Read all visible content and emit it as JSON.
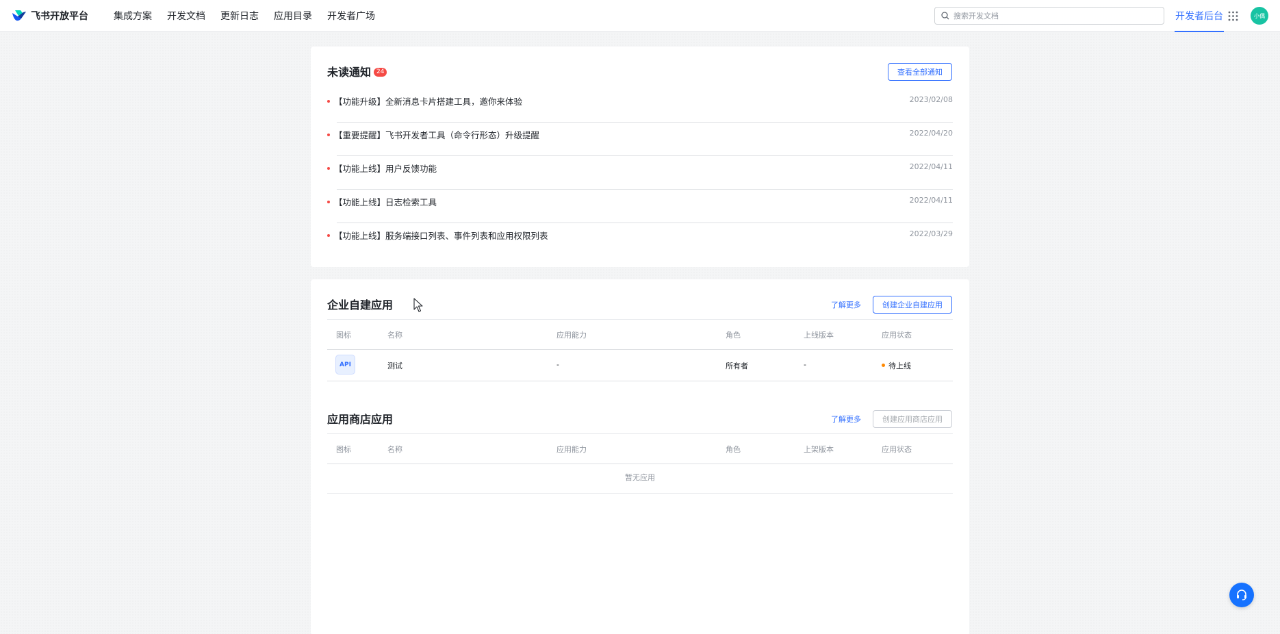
{
  "header": {
    "brand": "飞书开放平台",
    "nav": [
      "集成方案",
      "开发文档",
      "更新日志",
      "应用目录",
      "开发者广场"
    ],
    "search_placeholder": "搜索开发文档",
    "console_label": "开发者后台",
    "avatar_text": "小偶"
  },
  "notices": {
    "title": "未读通知",
    "count": "24",
    "view_all": "查看全部通知",
    "items": [
      {
        "text": "【功能升级】全新消息卡片搭建工具，邀你来体验",
        "date": "2023/02/08"
      },
      {
        "text": "【重要提醒】飞书开发者工具（命令行形态）升级提醒",
        "date": "2022/04/20"
      },
      {
        "text": "【功能上线】用户反馈功能",
        "date": "2022/04/11"
      },
      {
        "text": "【功能上线】日志检索工具",
        "date": "2022/04/11"
      },
      {
        "text": "【功能上线】服务端接口列表、事件列表和应用权限列表",
        "date": "2022/03/29"
      }
    ]
  },
  "enterprise_apps": {
    "title": "企业自建应用",
    "learn_more": "了解更多",
    "create_button": "创建企业自建应用",
    "columns": [
      "图标",
      "名称",
      "应用能力",
      "角色",
      "上线版本",
      "应用状态"
    ],
    "rows": [
      {
        "icon_text": "API",
        "name": "测试",
        "capability": "-",
        "role": "所有者",
        "version": "-",
        "status": "待上线"
      }
    ],
    "status_color": "#ff8800"
  },
  "store_apps": {
    "title": "应用商店应用",
    "learn_more": "了解更多",
    "create_button": "创建应用商店应用",
    "columns": [
      "图标",
      "名称",
      "应用能力",
      "角色",
      "上架版本",
      "应用状态"
    ],
    "empty_text": "暂无应用"
  },
  "colors": {
    "accent": "#3370ff",
    "badge": "#f54a45",
    "help_button": "#1672ff"
  }
}
